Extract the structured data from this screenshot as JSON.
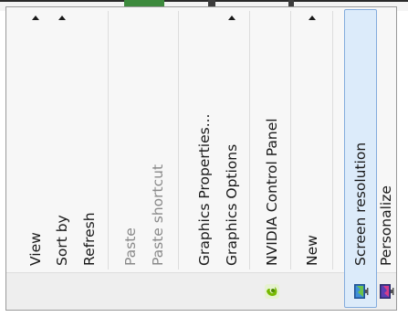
{
  "menu": {
    "items": [
      {
        "label": "View",
        "has_submenu": true,
        "enabled": true
      },
      {
        "label": "Sort by",
        "has_submenu": true,
        "enabled": true
      },
      {
        "label": "Refresh",
        "has_submenu": false,
        "enabled": true
      },
      {
        "label": "Paste",
        "has_submenu": false,
        "enabled": false
      },
      {
        "label": "Paste shortcut",
        "has_submenu": false,
        "enabled": false
      },
      {
        "label": "Graphics Properties...",
        "has_submenu": false,
        "enabled": true
      },
      {
        "label": "Graphics Options",
        "has_submenu": true,
        "enabled": true
      },
      {
        "label": "NVIDIA Control Panel",
        "has_submenu": false,
        "enabled": true,
        "icon": "nvidia-icon"
      },
      {
        "label": "New",
        "has_submenu": true,
        "enabled": true
      },
      {
        "label": "Screen resolution",
        "has_submenu": false,
        "enabled": true,
        "icon": "screen-resolution-icon",
        "highlighted": true
      },
      {
        "label": "Personalize",
        "has_submenu": false,
        "enabled": true,
        "icon": "personalize-icon"
      }
    ]
  },
  "colors": {
    "highlight_fill": "#dcebfa",
    "highlight_border": "#84acdd",
    "nvidia_green": "#76b900"
  }
}
